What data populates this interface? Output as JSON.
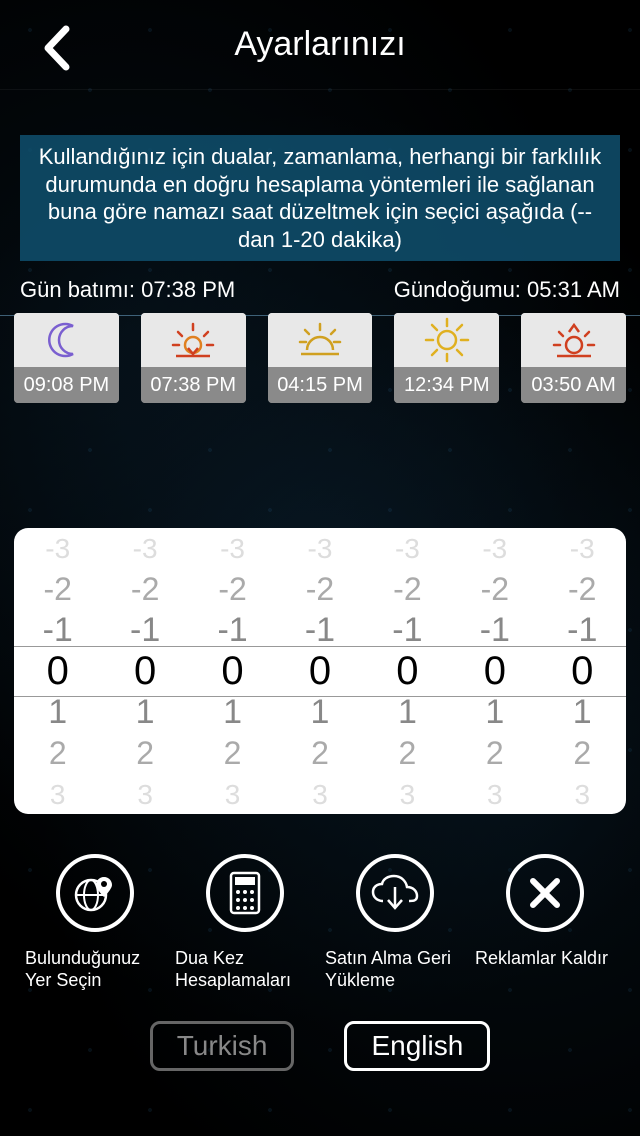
{
  "header": {
    "title": "Ayarlarınızı"
  },
  "info_text": "Kullandığınız için dualar, zamanlama, herhangi bir farklılık durumunda en doğru hesaplama yöntemleri ile sağlanan buna göre namazı saat düzeltmek için seçici aşağıda (--dan 1-20 dakika)",
  "sunset": {
    "label": "Gün batımı:",
    "time": "07:38 PM"
  },
  "sunrise": {
    "label": "Gündoğumu:",
    "time": "05:31 AM"
  },
  "cards": [
    {
      "icon": "moon",
      "time": "09:08 PM"
    },
    {
      "icon": "sunset",
      "time": "07:38 PM"
    },
    {
      "icon": "afternoon",
      "time": "04:15 PM"
    },
    {
      "icon": "sun",
      "time": "12:34 PM"
    },
    {
      "icon": "sunrise",
      "time": "03:50 AM"
    }
  ],
  "picker": {
    "columns": 7,
    "rows": [
      "-3",
      "-2",
      "-1",
      "0",
      "1",
      "2",
      "3"
    ],
    "selected": "0"
  },
  "actions": [
    {
      "icon": "globe",
      "label": "Bulunduğunuz Yer Seçin"
    },
    {
      "icon": "calculator",
      "label": "Dua Kez Hesaplamaları"
    },
    {
      "icon": "cloud",
      "label": "Satın Alma Geri Yükleme"
    },
    {
      "icon": "close",
      "label": "Reklamlar Kaldır"
    }
  ],
  "languages": {
    "turkish": "Turkish",
    "english": "English",
    "active": "english"
  }
}
